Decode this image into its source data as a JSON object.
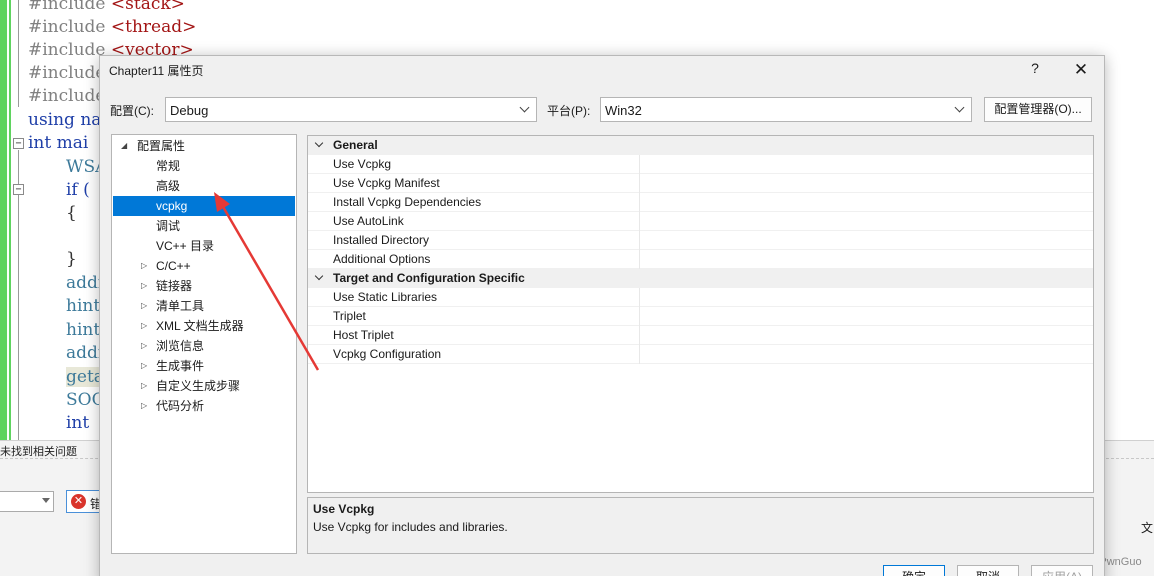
{
  "editor": {
    "lines": [
      {
        "text": "#include <stack>",
        "kind": "include"
      },
      {
        "text": "#include <thread>",
        "kind": "include"
      },
      {
        "text": "#include <vector>",
        "kind": "include"
      },
      {
        "text": "#include",
        "kind": "include"
      },
      {
        "text": "#include",
        "kind": "include"
      },
      {
        "text": "using na",
        "kind": "kw"
      },
      {
        "text": "int mai",
        "kind": "kw"
      },
      {
        "text": "WSAl",
        "kind": "ident"
      },
      {
        "text": "if (",
        "kind": "kw"
      },
      {
        "text": "{",
        "kind": "plain"
      },
      {
        "text": "}",
        "kind": "plain"
      },
      {
        "text": "addr",
        "kind": "ident"
      },
      {
        "text": "hint",
        "kind": "ident"
      },
      {
        "text": "hint",
        "kind": "ident"
      },
      {
        "text": "addr",
        "kind": "ident"
      },
      {
        "text": "geta",
        "kind": "hl"
      },
      {
        "text": "SOCl",
        "kind": "ident"
      },
      {
        "text": "int",
        "kind": "kw"
      }
    ]
  },
  "error_panel": {
    "status": "未找到相关问题",
    "error_button_label": "错",
    "right_label": "文"
  },
  "watermark": "CSDN @PwnGuo",
  "dialog": {
    "title": "Chapter11 属性页",
    "help_label": "?",
    "close_label": "✕",
    "config_label": "配置(C):",
    "config_value": "Debug",
    "platform_label": "平台(P):",
    "platform_value": "Win32",
    "config_manager_label": "配置管理器(O)...",
    "tree": [
      {
        "label": "配置属性",
        "level": 0,
        "arrow": "expanded"
      },
      {
        "label": "常规",
        "level": 1,
        "arrow": "none"
      },
      {
        "label": "高级",
        "level": 1,
        "arrow": "none"
      },
      {
        "label": "vcpkg",
        "level": 1,
        "arrow": "none",
        "selected": true
      },
      {
        "label": "调试",
        "level": 1,
        "arrow": "none"
      },
      {
        "label": "VC++ 目录",
        "level": 1,
        "arrow": "none"
      },
      {
        "label": "C/C++",
        "level": 1,
        "arrow": "collapsed"
      },
      {
        "label": "链接器",
        "level": 1,
        "arrow": "collapsed"
      },
      {
        "label": "清单工具",
        "level": 1,
        "arrow": "collapsed"
      },
      {
        "label": "XML 文档生成器",
        "level": 1,
        "arrow": "collapsed"
      },
      {
        "label": "浏览信息",
        "level": 1,
        "arrow": "collapsed"
      },
      {
        "label": "生成事件",
        "level": 1,
        "arrow": "collapsed"
      },
      {
        "label": "自定义生成步骤",
        "level": 1,
        "arrow": "collapsed"
      },
      {
        "label": "代码分析",
        "level": 1,
        "arrow": "collapsed"
      }
    ],
    "groups": [
      {
        "label": "General",
        "props": [
          "Use Vcpkg",
          "Use Vcpkg Manifest",
          "Install Vcpkg Dependencies",
          "Use AutoLink",
          "Installed Directory",
          "Additional Options"
        ]
      },
      {
        "label": "Target and Configuration Specific",
        "props": [
          "Use Static Libraries",
          "Triplet",
          "Host Triplet",
          "Vcpkg Configuration"
        ]
      }
    ],
    "description": {
      "title": "Use Vcpkg",
      "text": "Use Vcpkg for includes and libraries."
    },
    "buttons": {
      "ok": "确定",
      "cancel": "取消",
      "apply": "应用(A)"
    }
  },
  "colors": {
    "selection": "#0078d7",
    "annotation_arrow": "#e53935",
    "change_bar": "#5fd35f"
  }
}
